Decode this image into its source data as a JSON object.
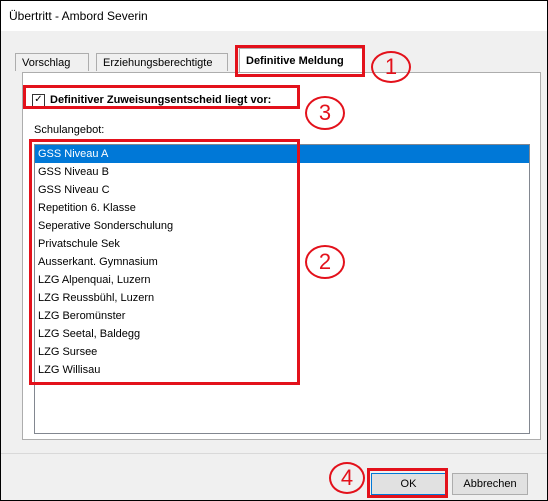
{
  "window": {
    "title": "Übertritt - Ambord Severin"
  },
  "tabs": [
    {
      "label": "Vorschlag",
      "active": false
    },
    {
      "label": "Erziehungsberechtigte",
      "active": false
    },
    {
      "label": "Definitive Meldung",
      "active": true
    }
  ],
  "checkbox": {
    "label": "Definitiver Zuweisungsentscheid liegt vor:",
    "checked": true,
    "check_glyph": "✓"
  },
  "list": {
    "label": "Schulangebot:",
    "items": [
      "GSS Niveau A",
      "GSS Niveau B",
      "GSS Niveau C",
      "Repetition 6. Klasse",
      "Seperative Sonderschulung",
      "Privatschule Sek",
      "Ausserkant. Gymnasium",
      "LZG Alpenquai, Luzern",
      "LZG Reussbühl, Luzern",
      "LZG Beromünster",
      "LZG Seetal, Baldegg",
      "LZG Sursee",
      "LZG Willisau"
    ],
    "selected_item": "GSS Niveau A"
  },
  "buttons": {
    "ok": "OK",
    "cancel": "Abbrechen"
  },
  "annotations": {
    "n1": "1",
    "n2": "2",
    "n3": "3",
    "n4": "4"
  },
  "colors": {
    "selection": "#0078d7",
    "annotation": "#e3111b"
  }
}
